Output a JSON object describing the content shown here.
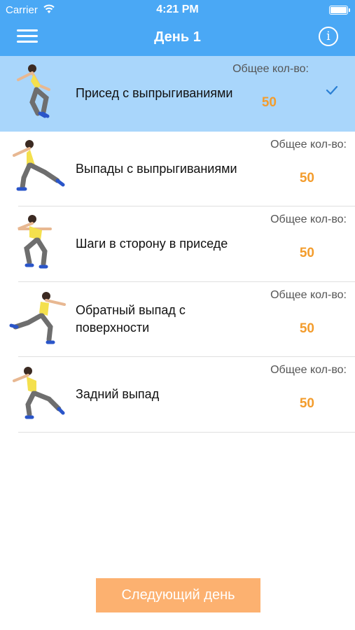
{
  "status_bar": {
    "carrier": "Carrier",
    "time": "4:21 PM"
  },
  "nav": {
    "title": "День 1",
    "menu_icon": "hamburger-menu-icon",
    "info_icon": "info-icon",
    "info_glyph": "i"
  },
  "exercises": [
    {
      "name": "Присед с выпрыгиваниями",
      "total_label": "Общее кол-во:",
      "total_value": "50",
      "selected": true
    },
    {
      "name": "Выпады с выпрыгиваниями",
      "total_label": "Общее кол-во:",
      "total_value": "50",
      "selected": false
    },
    {
      "name": "Шаги в сторону в приседе",
      "total_label": "Общее кол-во:",
      "total_value": "50",
      "selected": false
    },
    {
      "name": "Обратный выпад с поверхности",
      "total_label": "Общее кол-во:",
      "total_value": "50",
      "selected": false
    },
    {
      "name": "Задний выпад",
      "total_label": "Общее кол-во:",
      "total_value": "50",
      "selected": false
    }
  ],
  "footer": {
    "next_day_label": "Следующий день"
  },
  "colors": {
    "header": "#4aa8f5",
    "selected_row": "#a9d6fb",
    "count_value": "#f39c2c",
    "next_button": "#fcb170",
    "checkmark": "#2a7fd4"
  }
}
